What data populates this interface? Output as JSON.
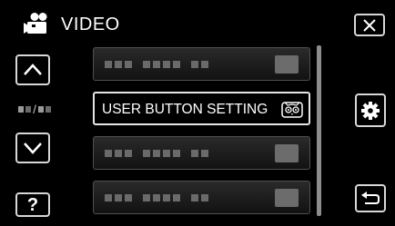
{
  "header": {
    "icon": "video-camera-icon",
    "title": "VIDEO"
  },
  "nav": {
    "up_icon": "chevron-up-icon",
    "down_icon": "chevron-down-icon",
    "page_indicator_separator": "/",
    "help_label": "?"
  },
  "menu": {
    "items": [
      {
        "label": "",
        "icon": "placeholder-icon",
        "state": "greyed"
      },
      {
        "label": "USER BUTTON SETTING",
        "icon": "owl-icon",
        "state": "selected"
      },
      {
        "label": "",
        "icon": "placeholder-icon",
        "state": "greyed"
      },
      {
        "label": "",
        "icon": "placeholder-icon",
        "state": "greyed"
      }
    ]
  },
  "right_panel": {
    "close_icon": "close-icon",
    "settings_icon": "gear-icon",
    "back_icon": "return-icon"
  },
  "colors": {
    "background": "#000000",
    "button_border": "#d8d8d8",
    "placeholder": "#6a6a6a",
    "text": "#ffffff"
  }
}
